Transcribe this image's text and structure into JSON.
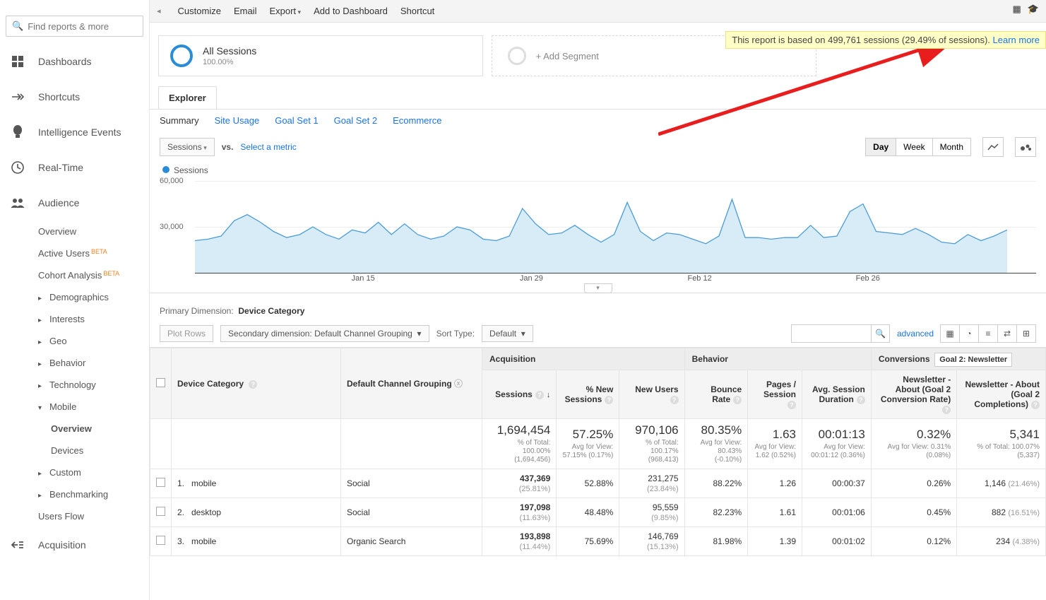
{
  "search_placeholder": "Find reports & more",
  "sidebar": {
    "main": [
      {
        "icon": "dashboard",
        "label": "Dashboards"
      },
      {
        "icon": "shortcut",
        "label": "Shortcuts"
      },
      {
        "icon": "bulb",
        "label": "Intelligence Events"
      },
      {
        "icon": "clock",
        "label": "Real-Time"
      },
      {
        "icon": "audience",
        "label": "Audience"
      }
    ],
    "audience_children": [
      {
        "label": "Overview"
      },
      {
        "label": "Active Users",
        "beta": "BETA"
      },
      {
        "label": "Cohort Analysis",
        "beta": "BETA"
      },
      {
        "label": "Demographics",
        "expandable": true
      },
      {
        "label": "Interests",
        "expandable": true
      },
      {
        "label": "Geo",
        "expandable": true
      },
      {
        "label": "Behavior",
        "expandable": true
      },
      {
        "label": "Technology",
        "expandable": true
      },
      {
        "label": "Mobile",
        "expandable": true,
        "expanded": true,
        "children": [
          {
            "label": "Overview",
            "active": true
          },
          {
            "label": "Devices"
          }
        ]
      },
      {
        "label": "Custom",
        "expandable": true
      },
      {
        "label": "Benchmarking",
        "expandable": true
      },
      {
        "label": "Users Flow"
      }
    ],
    "after": [
      {
        "icon": "acquisition",
        "label": "Acquisition"
      }
    ]
  },
  "topbar": {
    "items": [
      "Customize",
      "Email",
      "Export",
      "Add to Dashboard",
      "Shortcut"
    ],
    "export_dd": true
  },
  "notice": {
    "text": "This report is based on 499,761 sessions (29.49% of sessions). ",
    "link": "Learn more"
  },
  "segments": {
    "all": {
      "title": "All Sessions",
      "sub": "100.00%"
    },
    "add": "+ Add Segment"
  },
  "explorer_tab": "Explorer",
  "subtabs": [
    "Summary",
    "Site Usage",
    "Goal Set 1",
    "Goal Set 2",
    "Ecommerce"
  ],
  "chart": {
    "metric_selector": "Sessions",
    "vs": "vs.",
    "select_metric": "Select a metric",
    "time_buttons": [
      "Day",
      "Week",
      "Month"
    ],
    "legend": "Sessions",
    "yticks": [
      "60,000",
      "30,000"
    ],
    "xticks": [
      "Jan 15",
      "Jan 29",
      "Feb 12",
      "Feb 26"
    ]
  },
  "chart_data": {
    "type": "area",
    "title": "Sessions",
    "ylabel": "",
    "ylim": [
      0,
      60000
    ],
    "yticks": [
      30000,
      60000
    ],
    "x_labels": [
      "Jan 15",
      "Jan 29",
      "Feb 12",
      "Feb 26"
    ],
    "values": [
      21000,
      22000,
      24000,
      34000,
      38000,
      33000,
      27000,
      23000,
      25000,
      30000,
      25000,
      22000,
      28000,
      26000,
      33000,
      25000,
      32000,
      25000,
      22000,
      24000,
      30000,
      28000,
      22000,
      21000,
      24000,
      42000,
      32000,
      25000,
      26000,
      31000,
      25000,
      20000,
      25000,
      46000,
      27000,
      21000,
      26000,
      25000,
      22000,
      19000,
      24000,
      48000,
      23000,
      23000,
      22000,
      23000,
      23000,
      31000,
      23000,
      24000,
      40000,
      45000,
      27000,
      26000,
      25000,
      29000,
      25000,
      20000,
      19000,
      25000,
      21000,
      24000,
      28000
    ]
  },
  "primary_dim": {
    "label": "Primary Dimension:",
    "value": "Device Category"
  },
  "toolbar": {
    "plot_rows": "Plot Rows",
    "secondary_dim": "Secondary dimension: Default Channel Grouping",
    "sort_type_label": "Sort Type:",
    "sort_type_value": "Default",
    "advanced": "advanced"
  },
  "table": {
    "col_device": "Device Category",
    "col_channel": "Default Channel Grouping",
    "group_acq": "Acquisition",
    "group_beh": "Behavior",
    "group_conv": "Conversions",
    "goal_select": "Goal 2: Newsletter",
    "cols": {
      "sessions": "Sessions",
      "pct_new": "% New Sessions",
      "new_users": "New Users",
      "bounce": "Bounce Rate",
      "pps": "Pages / Session",
      "asd": "Avg. Session Duration",
      "conv_rate": "Newsletter - About (Goal 2 Conversion Rate)",
      "completions": "Newsletter - About (Goal 2 Completions)"
    },
    "totals": {
      "sessions": {
        "big": "1,694,454",
        "small": "% of Total: 100.00% (1,694,456)"
      },
      "pct_new": {
        "big": "57.25%",
        "small": "Avg for View: 57.15% (0.17%)"
      },
      "new_users": {
        "big": "970,106",
        "small": "% of Total: 100.17% (968,413)"
      },
      "bounce": {
        "big": "80.35%",
        "small": "Avg for View: 80.43% (-0.10%)"
      },
      "pps": {
        "big": "1.63",
        "small": "Avg for View: 1.62 (0.52%)"
      },
      "asd": {
        "big": "00:01:13",
        "small": "Avg for View: 00:01:12 (0.36%)"
      },
      "conv_rate": {
        "big": "0.32%",
        "small": "Avg for View: 0.31% (0.08%)"
      },
      "completions": {
        "big": "5,341",
        "small": "% of Total: 100.07% (5,337)"
      }
    },
    "rows": [
      {
        "n": "1.",
        "device": "mobile",
        "channel": "Social",
        "sessions": "437,369",
        "sessions_pct": "(25.81%)",
        "pct_new": "52.88%",
        "new_users": "231,275",
        "new_users_pct": "(23.84%)",
        "bounce": "88.22%",
        "pps": "1.26",
        "asd": "00:00:37",
        "conv_rate": "0.26%",
        "completions": "1,146",
        "completions_pct": "(21.46%)"
      },
      {
        "n": "2.",
        "device": "desktop",
        "channel": "Social",
        "sessions": "197,098",
        "sessions_pct": "(11.63%)",
        "pct_new": "48.48%",
        "new_users": "95,559",
        "new_users_pct": "(9.85%)",
        "bounce": "82.23%",
        "pps": "1.61",
        "asd": "00:01:06",
        "conv_rate": "0.45%",
        "completions": "882",
        "completions_pct": "(16.51%)"
      },
      {
        "n": "3.",
        "device": "mobile",
        "channel": "Organic Search",
        "sessions": "193,898",
        "sessions_pct": "(11.44%)",
        "pct_new": "75.69%",
        "new_users": "146,769",
        "new_users_pct": "(15.13%)",
        "bounce": "81.98%",
        "pps": "1.39",
        "asd": "00:01:02",
        "conv_rate": "0.12%",
        "completions": "234",
        "completions_pct": "(4.38%)"
      }
    ]
  }
}
